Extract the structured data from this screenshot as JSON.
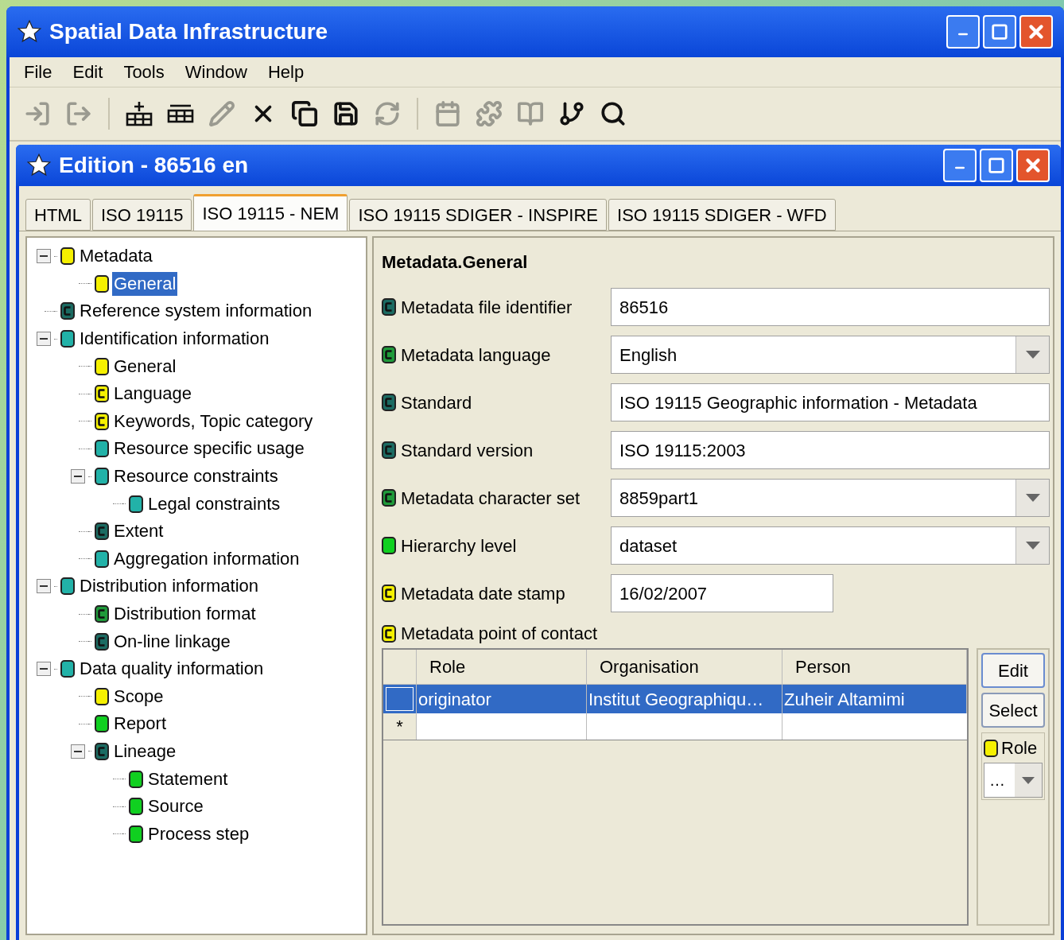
{
  "window": {
    "title": "Spatial Data Infrastructure"
  },
  "menu": [
    "File",
    "Edit",
    "Tools",
    "Window",
    "Help"
  ],
  "toolbar": [
    {
      "disabled": true
    },
    {
      "disabled": true
    },
    {
      "disabled": false
    },
    {
      "disabled": false
    },
    {
      "disabled": true
    },
    {
      "disabled": false
    },
    {
      "disabled": false
    },
    {
      "disabled": false
    },
    {
      "disabled": true
    },
    {
      "disabled": true
    },
    {
      "disabled": true
    },
    {
      "disabled": true
    },
    {
      "disabled": false
    },
    {
      "disabled": false
    }
  ],
  "inner_window": {
    "title": "Edition - 86516 en"
  },
  "tabs": [
    {
      "label": "HTML",
      "selected": false
    },
    {
      "label": "ISO 19115",
      "selected": false
    },
    {
      "label": "ISO 19115 - NEM",
      "selected": true
    },
    {
      "label": "ISO 19115 SDIGER - INSPIRE",
      "selected": false
    },
    {
      "label": "ISO 19115 SDIGER - WFD",
      "selected": false
    }
  ],
  "tree": [
    {
      "label": "Metadata",
      "color": "#f5f000",
      "kind": "plain",
      "expanded": true,
      "selected": false,
      "children": [
        {
          "label": "General",
          "color": "#f5f000",
          "kind": "plain",
          "selected": true
        }
      ]
    },
    {
      "label": "Reference system information",
      "color": "#1b6b62",
      "kind": "complex",
      "selected": false
    },
    {
      "label": "Identification information",
      "color": "#22b2a8",
      "kind": "plain",
      "expanded": true,
      "selected": false,
      "children": [
        {
          "label": "General",
          "color": "#f5f000",
          "kind": "plain",
          "selected": false
        },
        {
          "label": "Language",
          "color": "#f5f000",
          "kind": "complex",
          "selected": false
        },
        {
          "label": "Keywords, Topic category",
          "color": "#f5f000",
          "kind": "complex",
          "selected": false
        },
        {
          "label": "Resource specific usage",
          "color": "#22b2a8",
          "kind": "plain",
          "selected": false
        },
        {
          "label": "Resource constraints",
          "color": "#22b2a8",
          "kind": "plain",
          "expanded": true,
          "selected": false,
          "children": [
            {
              "label": "Legal constraints",
              "color": "#22b2a8",
              "kind": "plain",
              "selected": false
            }
          ]
        },
        {
          "label": "Extent",
          "color": "#1b6b62",
          "kind": "complex",
          "selected": false
        },
        {
          "label": "Aggregation information",
          "color": "#22b2a8",
          "kind": "plain",
          "selected": false
        }
      ]
    },
    {
      "label": "Distribution information",
      "color": "#22b2a8",
      "kind": "plain",
      "expanded": true,
      "selected": false,
      "children": [
        {
          "label": "Distribution format",
          "color": "#1f9a3a",
          "kind": "complex",
          "selected": false
        },
        {
          "label": "On-line linkage",
          "color": "#1b6b62",
          "kind": "complex",
          "selected": false
        }
      ]
    },
    {
      "label": "Data quality information",
      "color": "#22b2a8",
      "kind": "plain",
      "expanded": true,
      "selected": false,
      "children": [
        {
          "label": "Scope",
          "color": "#f5f000",
          "kind": "plain",
          "selected": false
        },
        {
          "label": "Report",
          "color": "#10d020",
          "kind": "plain",
          "selected": false
        },
        {
          "label": "Lineage",
          "color": "#1b6b62",
          "kind": "complex",
          "expanded": true,
          "selected": false,
          "children": [
            {
              "label": "Statement",
              "color": "#10d020",
              "kind": "plain",
              "selected": false
            },
            {
              "label": "Source",
              "color": "#10d020",
              "kind": "plain",
              "selected": false
            },
            {
              "label": "Process step",
              "color": "#10d020",
              "kind": "plain",
              "selected": false
            }
          ]
        }
      ]
    }
  ],
  "form": {
    "heading": "Metadata.General",
    "fields": [
      {
        "label": "Metadata file identifier",
        "color": "#1b6b62",
        "kind": "text",
        "value": "86516"
      },
      {
        "label": "Metadata language",
        "color": "#1f9a3a",
        "kind": "select",
        "value": "English"
      },
      {
        "label": "Standard",
        "color": "#1b6b62",
        "kind": "text",
        "value": "ISO 19115 Geographic information - Metadata"
      },
      {
        "label": "Standard version",
        "color": "#1b6b62",
        "kind": "text",
        "value": "ISO 19115:2003"
      },
      {
        "label": "Metadata character set",
        "color": "#1f9a3a",
        "kind": "select",
        "value": "8859part1"
      },
      {
        "label": "Hierarchy level",
        "color": "#10d020",
        "kind": "select_plain",
        "value": "dataset"
      },
      {
        "label": "Metadata date stamp",
        "color": "#f5f000",
        "kind": "date",
        "value": "16/02/2007"
      }
    ],
    "contact": {
      "label": "Metadata point of contact",
      "color": "#f5f000",
      "columns": [
        "Role",
        "Organisation",
        "Person"
      ],
      "rows": [
        {
          "cells": [
            "originator",
            "Institut Geographiqu…",
            "Zuheir Altamimi"
          ],
          "selected": true
        }
      ],
      "new_row_marker": "*",
      "buttons": [
        "Edit",
        "Select"
      ],
      "role": {
        "label": "Role",
        "color": "#f5f000",
        "value": "…"
      }
    }
  }
}
